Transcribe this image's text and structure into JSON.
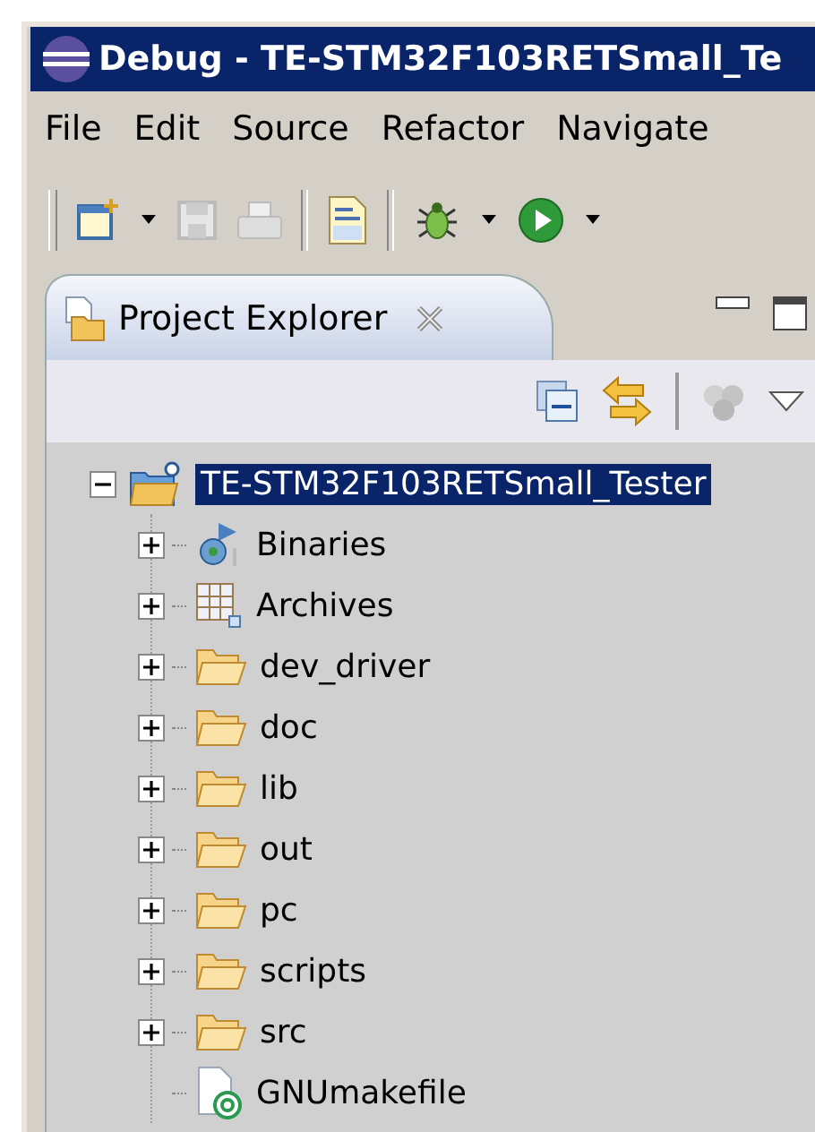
{
  "window": {
    "title": "Debug - TE-STM32F103RETSmall_Te"
  },
  "menu": [
    "File",
    "Edit",
    "Source",
    "Refactor",
    "Navigate"
  ],
  "view": {
    "title": "Project Explorer"
  },
  "tree": {
    "label": "TE-STM32F103RETSmall_Tester",
    "kind": "project",
    "expanded": true,
    "selected": true,
    "children": [
      {
        "label": "Binaries",
        "kind": "binaries",
        "expanded": false,
        "selected": false
      },
      {
        "label": "Archives",
        "kind": "archives",
        "expanded": false,
        "selected": false
      },
      {
        "label": "dev_driver",
        "kind": "folder",
        "expanded": false,
        "selected": false
      },
      {
        "label": "doc",
        "kind": "folder",
        "expanded": false,
        "selected": false
      },
      {
        "label": "lib",
        "kind": "folder",
        "expanded": false,
        "selected": false
      },
      {
        "label": "out",
        "kind": "folder",
        "expanded": false,
        "selected": false
      },
      {
        "label": "pc",
        "kind": "folder",
        "expanded": false,
        "selected": false
      },
      {
        "label": "scripts",
        "kind": "folder",
        "expanded": false,
        "selected": false
      },
      {
        "label": "src",
        "kind": "folder",
        "expanded": false,
        "selected": false
      },
      {
        "label": "GNUmakefile",
        "kind": "file",
        "selected": false
      }
    ]
  }
}
